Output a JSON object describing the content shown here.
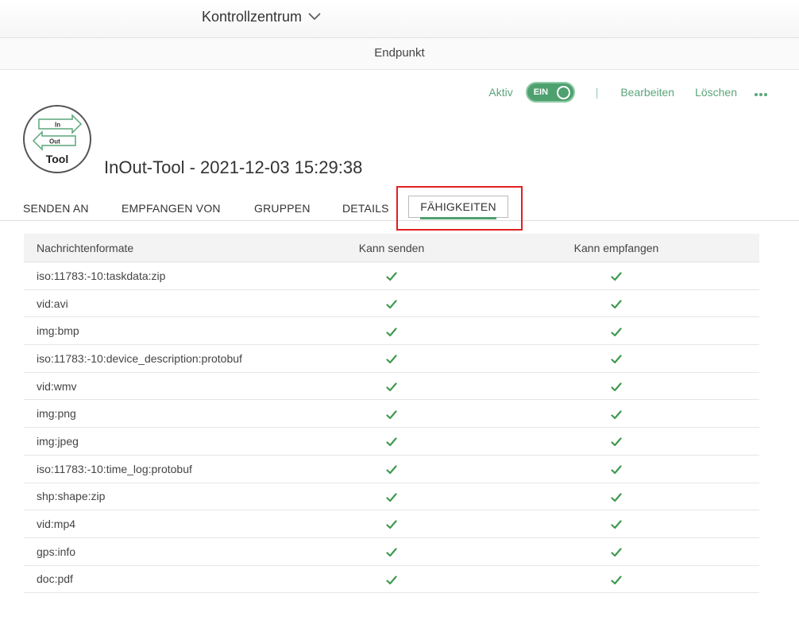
{
  "header": {
    "context": "Kontrollzentrum",
    "section": "Endpunkt"
  },
  "actions": {
    "status_label": "Aktiv",
    "toggle_label": "EIN",
    "separator": "|",
    "edit": "Bearbeiten",
    "delete": "Löschen"
  },
  "endpoint": {
    "logo_in": "In",
    "logo_out": "Out",
    "logo_tool": "Tool",
    "title": "InOut-Tool - 2021-12-03 15:29:38"
  },
  "tabs": [
    {
      "label": "SENDEN AN"
    },
    {
      "label": "EMPFANGEN VON"
    },
    {
      "label": "GRUPPEN"
    },
    {
      "label": "DETAILS"
    },
    {
      "label": "FÄHIGKEITEN",
      "active": true
    }
  ],
  "table": {
    "columns": [
      "Nachrichtenformate",
      "Kann senden",
      "Kann empfangen"
    ],
    "rows": [
      {
        "format": "iso:11783:-10:taskdata:zip",
        "send": true,
        "receive": true
      },
      {
        "format": "vid:avi",
        "send": true,
        "receive": true
      },
      {
        "format": "img:bmp",
        "send": true,
        "receive": true
      },
      {
        "format": "iso:11783:-10:device_description:protobuf",
        "send": true,
        "receive": true
      },
      {
        "format": "vid:wmv",
        "send": true,
        "receive": true
      },
      {
        "format": "img:png",
        "send": true,
        "receive": true
      },
      {
        "format": "img:jpeg",
        "send": true,
        "receive": true
      },
      {
        "format": "iso:11783:-10:time_log:protobuf",
        "send": true,
        "receive": true
      },
      {
        "format": "shp:shape:zip",
        "send": true,
        "receive": true
      },
      {
        "format": "vid:mp4",
        "send": true,
        "receive": true
      },
      {
        "format": "gps:info",
        "send": true,
        "receive": true
      },
      {
        "format": "doc:pdf",
        "send": true,
        "receive": true
      }
    ]
  },
  "colors": {
    "accent": "#4ea06f",
    "link": "#5aa67a",
    "check": "#3f9a4f",
    "highlight": "#e02020"
  },
  "icons": {
    "context_dropdown": "chevron-down-icon",
    "more": "more-dots-icon",
    "capability": "check-icon"
  }
}
